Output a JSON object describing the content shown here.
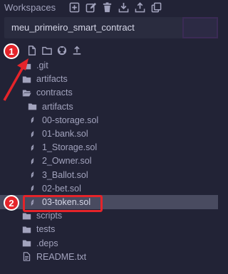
{
  "header": {
    "title": "Workspaces",
    "actions": [
      {
        "name": "create-workspace-icon",
        "icon": "plus-square"
      },
      {
        "name": "rename-workspace-icon",
        "icon": "edit"
      },
      {
        "name": "delete-workspace-icon",
        "icon": "trash"
      },
      {
        "name": "download-workspace-icon",
        "icon": "download"
      },
      {
        "name": "restore-workspace-icon",
        "icon": "upload"
      },
      {
        "name": "clone-workspace-icon",
        "icon": "copy"
      }
    ]
  },
  "workspace_select": {
    "value": "meu_primeiro_smart_contract"
  },
  "file_toolbar": [
    {
      "name": "new-file-icon",
      "icon": "file"
    },
    {
      "name": "new-folder-icon",
      "icon": "folder"
    },
    {
      "name": "github-icon",
      "icon": "github"
    },
    {
      "name": "upload-icon",
      "icon": "upload"
    }
  ],
  "tree": [
    {
      "label": ".git",
      "type": "folder",
      "depth": 0
    },
    {
      "label": "artifacts",
      "type": "folder",
      "depth": 0
    },
    {
      "label": "contracts",
      "type": "folder-open",
      "depth": 0
    },
    {
      "label": "artifacts",
      "type": "folder",
      "depth": 1
    },
    {
      "label": "00-storage.sol",
      "type": "solidity",
      "depth": 1
    },
    {
      "label": "01-bank.sol",
      "type": "solidity",
      "depth": 1
    },
    {
      "label": "1_Storage.sol",
      "type": "solidity",
      "depth": 1
    },
    {
      "label": "2_Owner.sol",
      "type": "solidity",
      "depth": 1
    },
    {
      "label": "3_Ballot.sol",
      "type": "solidity",
      "depth": 1
    },
    {
      "label": "02-bet.sol",
      "type": "solidity",
      "depth": 1
    },
    {
      "label": "03-token.sol",
      "type": "solidity",
      "depth": 1,
      "selected": true
    },
    {
      "label": "scripts",
      "type": "folder",
      "depth": 0
    },
    {
      "label": "tests",
      "type": "folder",
      "depth": 0
    },
    {
      "label": ".deps",
      "type": "folder",
      "depth": 0
    },
    {
      "label": "README.txt",
      "type": "file",
      "depth": 0
    }
  ],
  "annotations": [
    {
      "number": "1"
    },
    {
      "number": "2"
    }
  ],
  "colors": {
    "background": "#222336",
    "text": "#a2a3bd",
    "selected_row": "#494b60",
    "annotation_red": "#e5242a"
  }
}
